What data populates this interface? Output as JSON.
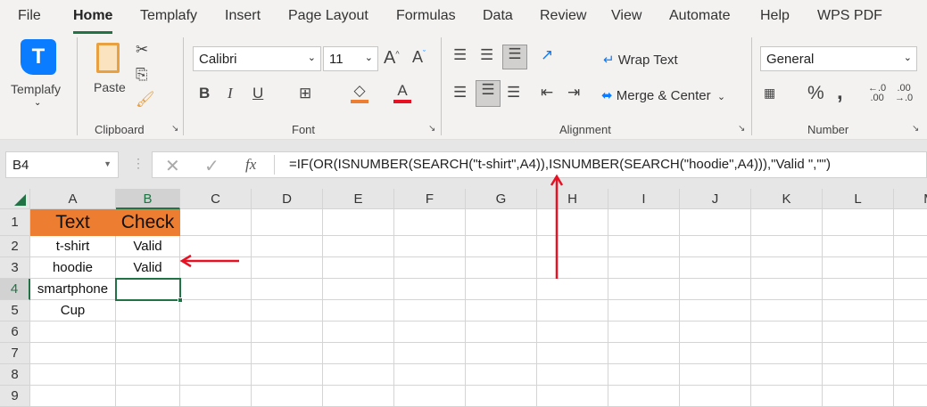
{
  "menu_tabs": [
    "File",
    "Home",
    "Templafy",
    "Insert",
    "Page Layout",
    "Formulas",
    "Data",
    "Review",
    "View",
    "Automate",
    "Help",
    "WPS PDF"
  ],
  "ribbon": {
    "templafy_label": "Templafy",
    "paste_label": "Paste",
    "clipboard_label": "Clipboard",
    "font_name": "Calibri",
    "font_size": "11",
    "font_label": "Font",
    "wrap_text": "Wrap Text",
    "merge_center": "Merge & Center",
    "alignment_label": "Alignment",
    "number_format": "General",
    "number_label": "Number",
    "fill_color": "#ed7d31",
    "font_color": "#e81123"
  },
  "name_box": "B4",
  "formula": "=IF(OR(ISNUMBER(SEARCH(\"t-shirt\",A4)),ISNUMBER(SEARCH(\"hoodie\",A4))),\"Valid \",\"\")",
  "columns": [
    "A",
    "B",
    "C",
    "D",
    "E",
    "F",
    "G",
    "H",
    "I",
    "J",
    "K",
    "L",
    "M"
  ],
  "rows": [
    "1",
    "2",
    "3",
    "4",
    "5",
    "6",
    "7",
    "8",
    "9"
  ],
  "cells": {
    "A1": "Text",
    "B1": "Check",
    "A2": "t-shirt",
    "B2": "Valid",
    "A3": "hoodie",
    "B3": "Valid",
    "A4": "smartphone",
    "B4": "",
    "A5": "Cup"
  },
  "colors": {
    "accent": "#217346",
    "header_fill": "#ed7d31",
    "arrow": "#e81123"
  }
}
